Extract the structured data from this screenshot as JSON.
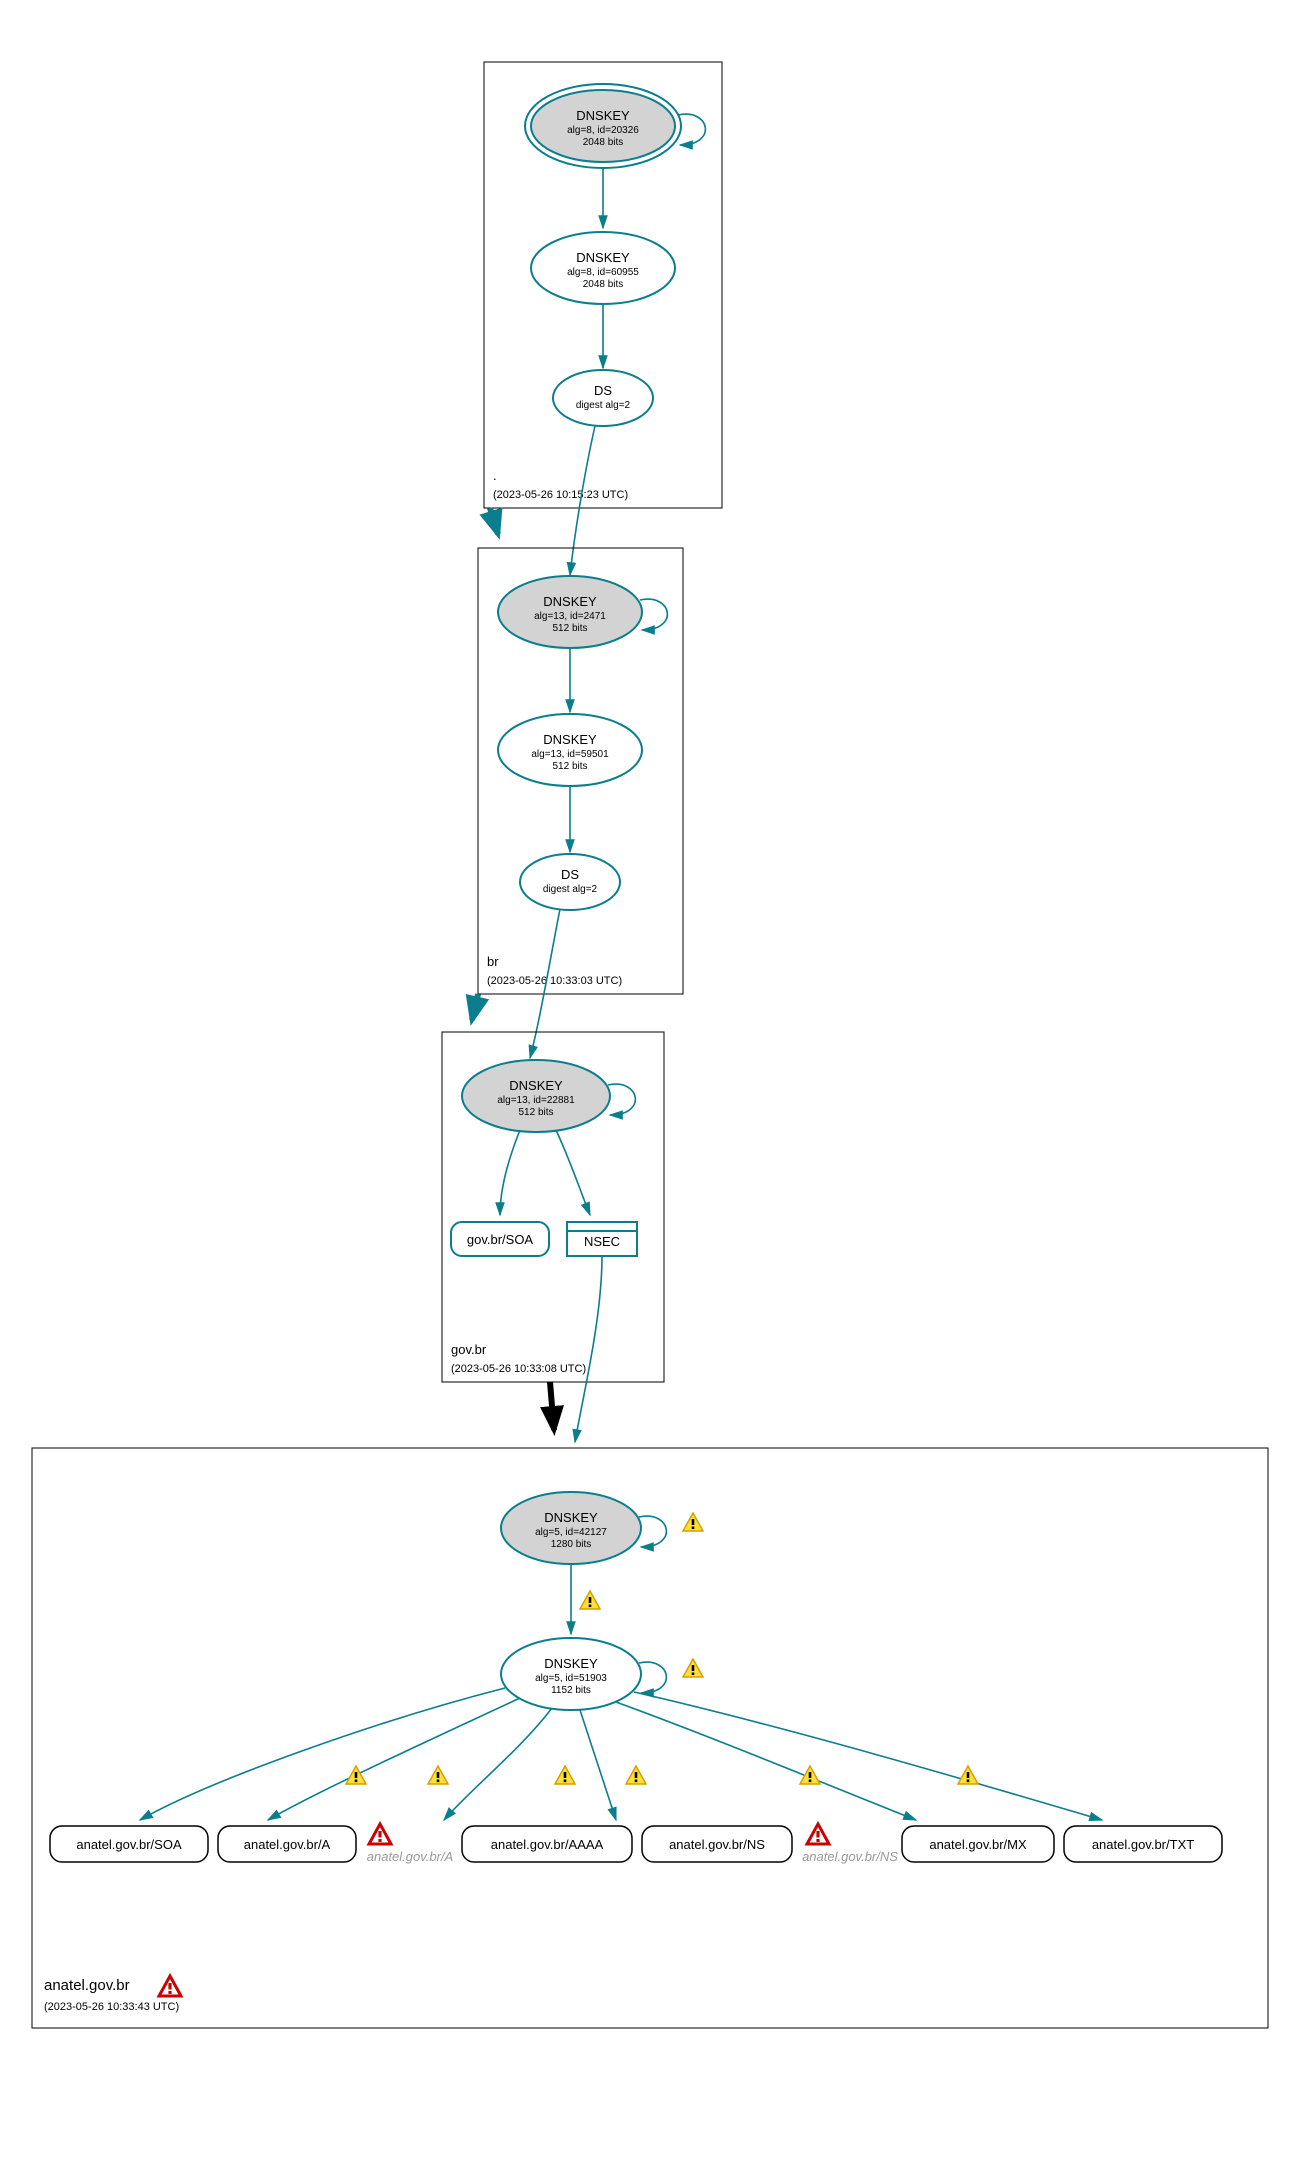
{
  "zones": {
    "root": {
      "label": ".",
      "timestamp": "(2023-05-26 10:15:23 UTC)"
    },
    "br": {
      "label": "br",
      "timestamp": "(2023-05-26 10:33:03 UTC)"
    },
    "govbr": {
      "label": "gov.br",
      "timestamp": "(2023-05-26 10:33:08 UTC)"
    },
    "anatel": {
      "label": "anatel.gov.br",
      "timestamp": "(2023-05-26 10:33:43 UTC)"
    }
  },
  "nodes": {
    "root_ksk": {
      "title": "DNSKEY",
      "sub1": "alg=8, id=20326",
      "sub2": "2048 bits"
    },
    "root_zsk": {
      "title": "DNSKEY",
      "sub1": "alg=8, id=60955",
      "sub2": "2048 bits"
    },
    "root_ds": {
      "title": "DS",
      "sub1": "digest alg=2"
    },
    "br_ksk": {
      "title": "DNSKEY",
      "sub1": "alg=13, id=2471",
      "sub2": "512 bits"
    },
    "br_zsk": {
      "title": "DNSKEY",
      "sub1": "alg=13, id=59501",
      "sub2": "512 bits"
    },
    "br_ds": {
      "title": "DS",
      "sub1": "digest alg=2"
    },
    "govbr_ksk": {
      "title": "DNSKEY",
      "sub1": "alg=13, id=22881",
      "sub2": "512 bits"
    },
    "govbr_soa": {
      "title": "gov.br/SOA"
    },
    "govbr_nsec": {
      "title": "NSEC"
    },
    "anatel_ksk": {
      "title": "DNSKEY",
      "sub1": "alg=5, id=42127",
      "sub2": "1280 bits"
    },
    "anatel_zsk": {
      "title": "DNSKEY",
      "sub1": "alg=5, id=51903",
      "sub2": "1152 bits"
    }
  },
  "rrsets": {
    "soa": "anatel.gov.br/SOA",
    "a": "anatel.gov.br/A",
    "a_ghost": "anatel.gov.br/A",
    "aaaa": "anatel.gov.br/AAAA",
    "ns": "anatel.gov.br/NS",
    "ns_ghost": "anatel.gov.br/NS",
    "mx": "anatel.gov.br/MX",
    "txt": "anatel.gov.br/TXT"
  }
}
